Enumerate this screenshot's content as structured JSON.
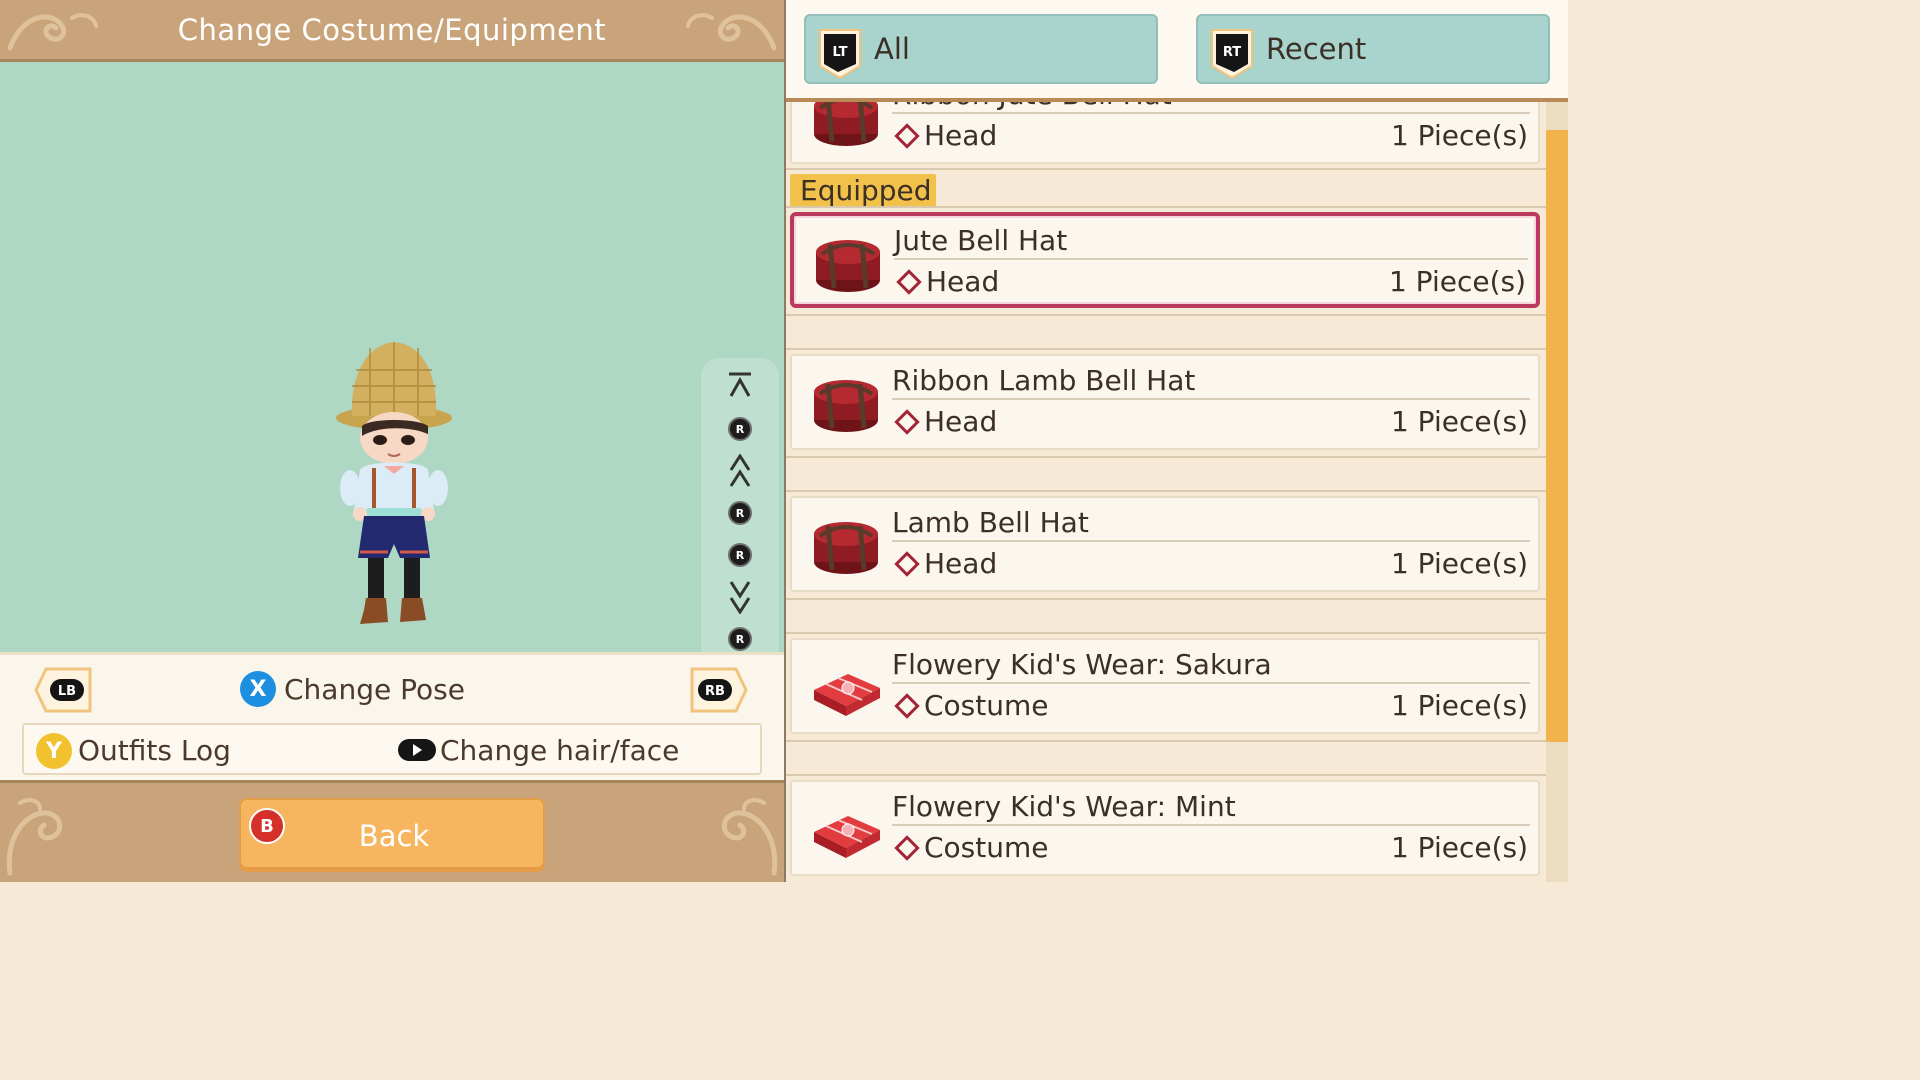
{
  "header": {
    "title": "Change Costume/Equipment"
  },
  "camera_controls": [
    {
      "name": "camera-top-button",
      "glyph": "⊼"
    },
    {
      "name": "camera-rotate-up-button",
      "glyph": "R"
    },
    {
      "name": "camera-zoom-in-button",
      "glyph": "⋀"
    },
    {
      "name": "camera-rotate-left-button",
      "glyph": "R"
    },
    {
      "name": "camera-rotate-right-button",
      "glyph": "R"
    },
    {
      "name": "camera-zoom-out-button",
      "glyph": "⋁"
    },
    {
      "name": "camera-rotate-down-button",
      "glyph": "R"
    },
    {
      "name": "camera-bottom-button",
      "glyph": "⊻"
    }
  ],
  "controls": {
    "lb": "LB",
    "rb": "RB",
    "x": "X",
    "change_pose": "Change Pose",
    "y": "Y",
    "outfits_log": "Outfits Log",
    "change_hair_face": "Change hair/face"
  },
  "back": {
    "b": "B",
    "label": "Back"
  },
  "tabs": [
    {
      "badge": "LT",
      "label": "All"
    },
    {
      "badge": "RT",
      "label": "Recent"
    }
  ],
  "equipped_label": "Equipped",
  "items": [
    {
      "name": "Ribbon Jute Bell Hat",
      "slot": "Head",
      "qty": "1 Piece(s)",
      "kind": "hat"
    },
    {
      "name": "Jute Bell Hat",
      "slot": "Head",
      "qty": "1 Piece(s)",
      "kind": "hat",
      "selected": true
    },
    {
      "name": "Ribbon Lamb Bell Hat",
      "slot": "Head",
      "qty": "1 Piece(s)",
      "kind": "hat"
    },
    {
      "name": "Lamb Bell Hat",
      "slot": "Head",
      "qty": "1 Piece(s)",
      "kind": "hat"
    },
    {
      "name": "Flowery Kid's Wear: Sakura",
      "slot": "Costume",
      "qty": "1 Piece(s)",
      "kind": "costume"
    },
    {
      "name": "Flowery Kid's Wear: Mint",
      "slot": "Costume",
      "qty": "1 Piece(s)",
      "kind": "costume"
    }
  ]
}
